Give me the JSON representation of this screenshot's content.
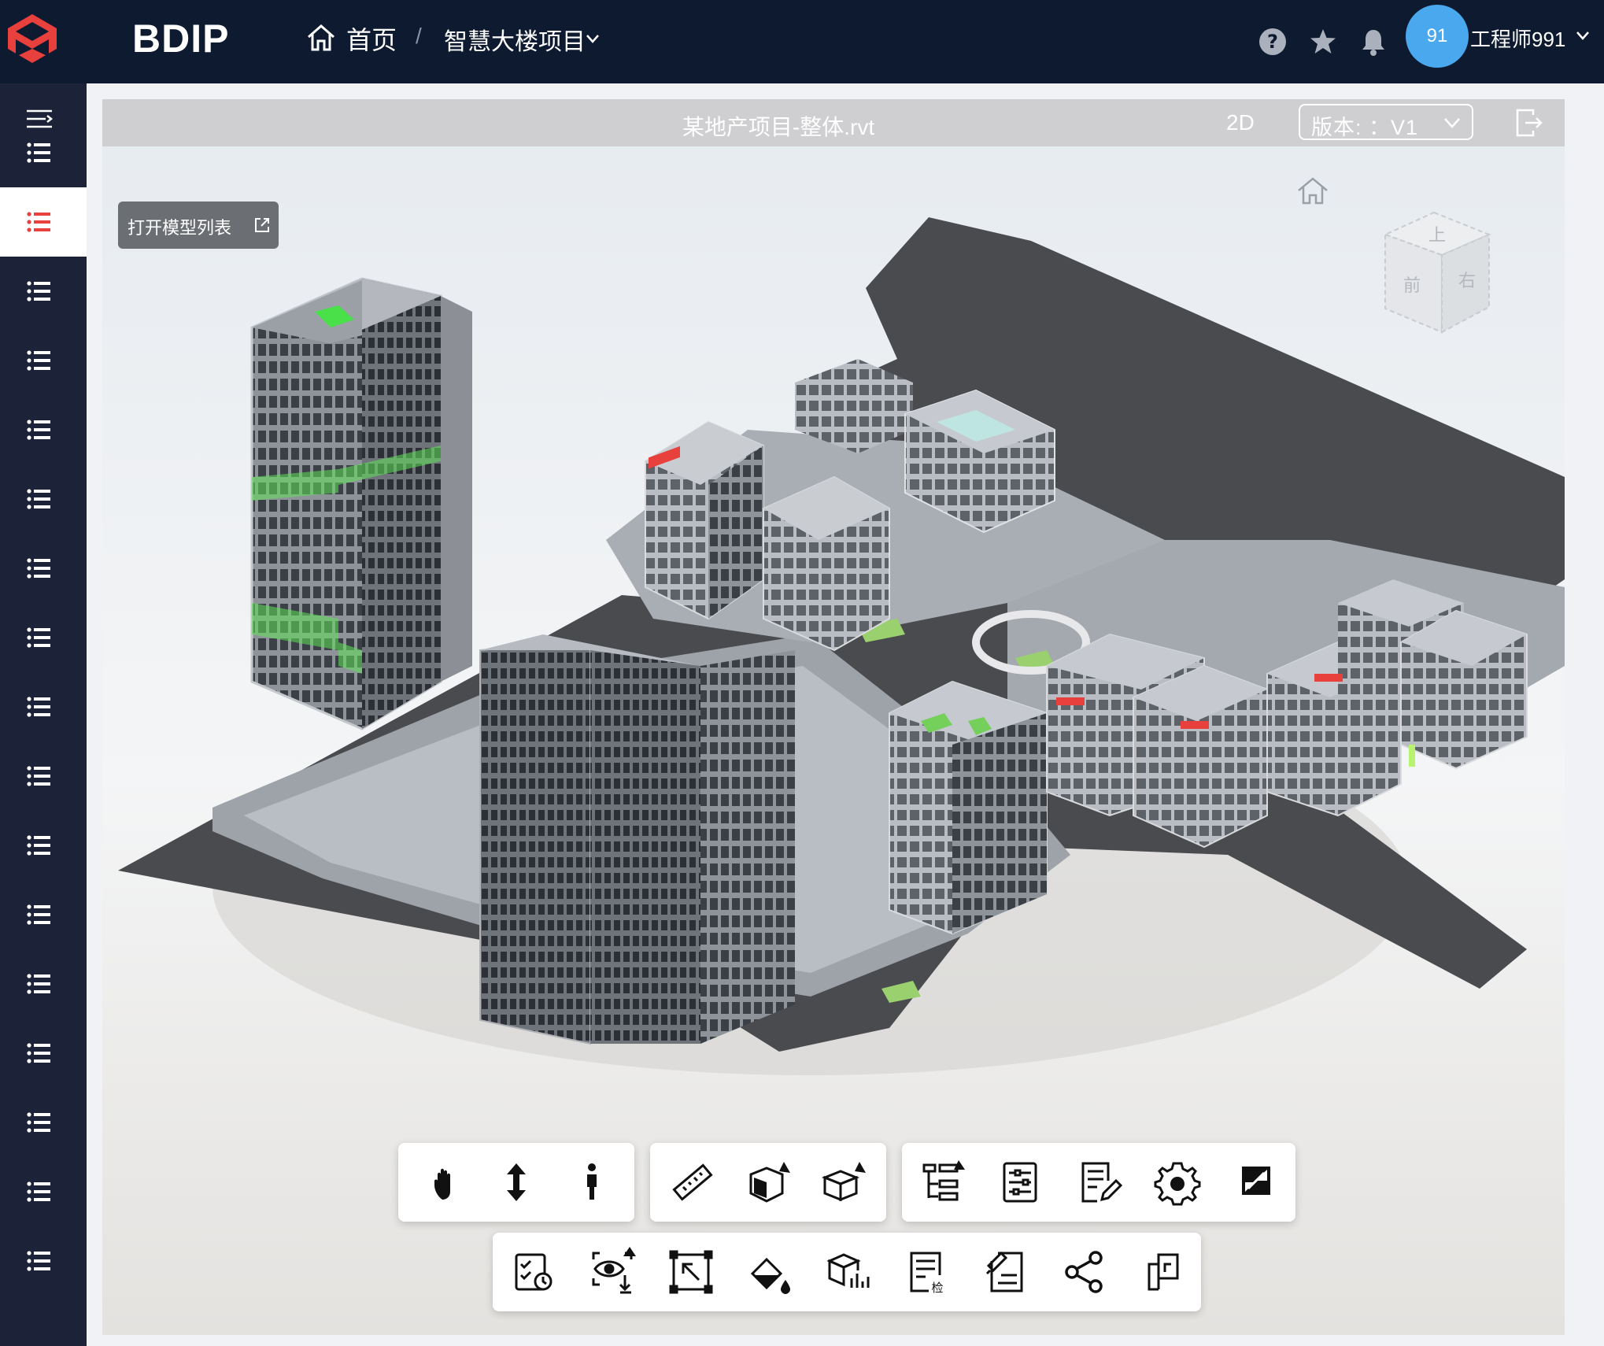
{
  "header": {
    "brand": "BDIP",
    "breadcrumb_home": "首页",
    "breadcrumb_separator": "/",
    "breadcrumb_project": "智慧大楼项目",
    "avatar_text": "91",
    "username": "工程师991",
    "accent_color": "#4aa8ef",
    "bg_color": "#0e1a30"
  },
  "sidebar": {
    "active_index": 1,
    "active_color": "#e8403c",
    "item_count": 17
  },
  "viewer": {
    "file_title": "某地产项目-整体.rvt",
    "mode_label": "2D",
    "version_label": "版本: ：V1",
    "open_model_list": "打开模型列表",
    "viewcube": {
      "top": "上",
      "front": "前",
      "right": "右"
    }
  },
  "toolbar": {
    "row1": [
      {
        "group": "navigation",
        "tools": [
          "pan-hand-icon",
          "vertical-move-icon",
          "person-walk-icon"
        ]
      },
      {
        "group": "measure",
        "tools": [
          "ruler-icon",
          "section-box-icon",
          "explode-box-icon"
        ]
      },
      {
        "group": "settings",
        "tools": [
          "model-tree-icon",
          "properties-icon",
          "property-edit-icon",
          "settings-gear-icon",
          "fullscreen-icon"
        ]
      }
    ],
    "row2": [
      "schedule-icon",
      "view-hide-icon",
      "zoom-fit-icon",
      "paint-bucket-icon",
      "model-stats-icon",
      "inspection-icon",
      "annotation-icon",
      "share-icon",
      "export-icon"
    ]
  }
}
